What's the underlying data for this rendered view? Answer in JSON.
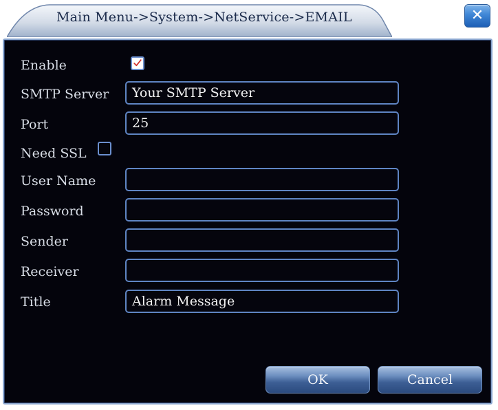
{
  "window": {
    "title": "Main Menu->System->NetService->EMAIL",
    "close_icon": "close-icon"
  },
  "form": {
    "enable": {
      "label": "Enable",
      "checked": true
    },
    "smtp_server": {
      "label": "SMTP Server",
      "value": "Your SMTP Server"
    },
    "port": {
      "label": "Port",
      "value": "25"
    },
    "need_ssl": {
      "label": "Need SSL",
      "checked": false
    },
    "user_name": {
      "label": "User Name",
      "value": ""
    },
    "password": {
      "label": "Password",
      "value": ""
    },
    "sender": {
      "label": "Sender",
      "value": ""
    },
    "receiver": {
      "label": "Receiver",
      "value": ""
    },
    "title": {
      "label": "Title",
      "value": "Alarm Message"
    }
  },
  "buttons": {
    "ok_label": "OK",
    "cancel_label": "Cancel"
  },
  "colors": {
    "panel_background": "#04040c",
    "field_border": "#5f85c4",
    "button_blue": "#3d5f95",
    "checkmark_red": "#d4322c"
  }
}
